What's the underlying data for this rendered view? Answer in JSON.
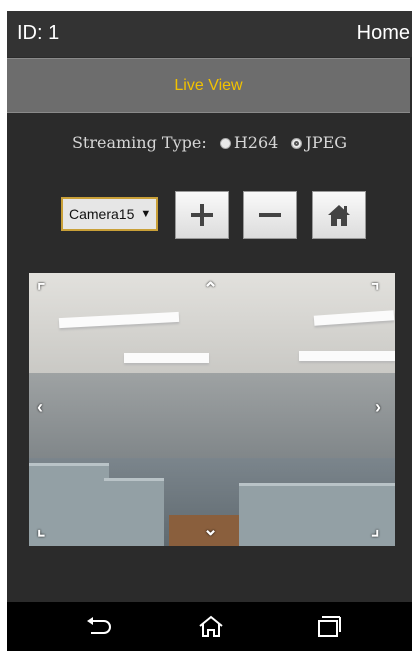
{
  "topbar": {
    "id_text": "ID: 1",
    "home_label": "Home"
  },
  "tab": {
    "label": "Live View",
    "color": "#f2c200"
  },
  "streaming": {
    "label": "Streaming Type:",
    "options": [
      "H264",
      "JPEG"
    ],
    "selected": "JPEG"
  },
  "camera_select": {
    "value": "Camera15"
  },
  "controls": {
    "zoom_in_icon": "plus-icon",
    "zoom_out_icon": "minus-icon",
    "home_icon": "home-icon"
  },
  "nav": {
    "back_icon": "back-icon",
    "home_icon": "home-icon",
    "recents_icon": "recents-icon"
  }
}
